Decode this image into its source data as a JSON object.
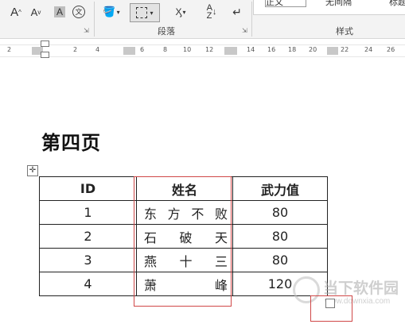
{
  "ribbon": {
    "font_grow_label": "A",
    "font_shrink_label": "A",
    "char_shading_label": "A",
    "phonetic_label": "文",
    "paragraph_group_label": "段落",
    "styles_group_label": "样式",
    "styles": [
      "正文",
      "无间隔",
      "标题"
    ]
  },
  "ruler": {
    "numbers": [
      "2",
      "2",
      "4",
      "6",
      "8",
      "10",
      "12",
      "14",
      "16",
      "18",
      "20",
      "22",
      "24",
      "26"
    ]
  },
  "document": {
    "heading": "第四页",
    "table": {
      "headers": [
        "ID",
        "姓名",
        "武力值"
      ],
      "rows": [
        {
          "id": "1",
          "name": [
            "东",
            "方",
            "不",
            "败"
          ],
          "power": "80"
        },
        {
          "id": "2",
          "name": [
            "石",
            "破",
            "天"
          ],
          "power": "80"
        },
        {
          "id": "3",
          "name": [
            "燕",
            "十",
            "三"
          ],
          "power": "80"
        },
        {
          "id": "4",
          "name": [
            "萧",
            "峰"
          ],
          "power": "120"
        }
      ]
    }
  },
  "watermark": {
    "text": "当下软件园",
    "url": "www.downxia.com"
  }
}
